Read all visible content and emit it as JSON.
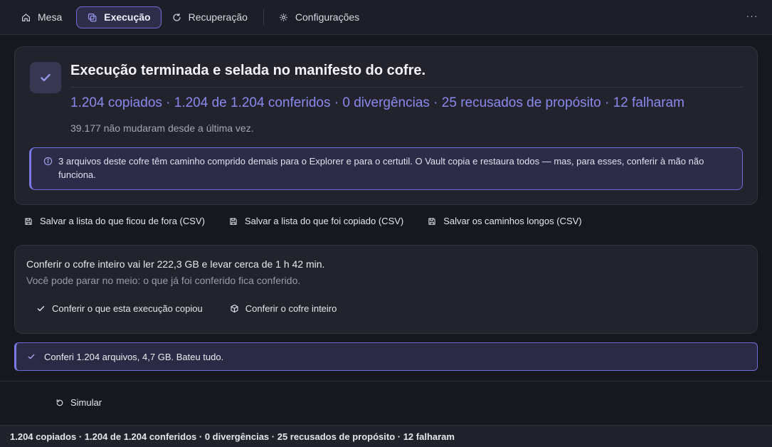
{
  "tabs": [
    {
      "label": "Mesa",
      "icon": "home-icon"
    },
    {
      "label": "Execução",
      "icon": "copy-icon",
      "active": true
    },
    {
      "label": "Recuperação",
      "icon": "refresh-icon"
    },
    {
      "label": "Configurações",
      "icon": "gear-icon"
    }
  ],
  "result": {
    "title": "Execução terminada e selada no manifesto do cofre.",
    "summary": "1.204 copiados · 1.204 de 1.204 conferidos · 0 divergências · 25 recusados de propósito · 12 falharam",
    "unchanged_note": "39.177 não mudaram desde a última vez.",
    "info": "3 arquivos deste cofre têm caminho comprido demais para o Explorer e para o certutil. O Vault copia e restaura todos — mas, para esses, conferir à mão não funciona."
  },
  "save_actions": {
    "left_out": "Salvar a lista do que ficou de fora (CSV)",
    "copied": "Salvar a lista do que foi copiado (CSV)",
    "long_paths": "Salvar os caminhos longos (CSV)"
  },
  "verify": {
    "line1": "Conferir o cofre inteiro vai ler 222,3 GB e levar cerca de 1 h 42 min.",
    "line2": "Você pode parar no meio: o que já foi conferido fica conferido.",
    "verify_run_label": "Conferir o que esta execução copiou",
    "verify_all_label": "Conferir o cofre inteiro"
  },
  "success_message": "Conferi 1.204 arquivos, 4,7 GB. Bateu tudo.",
  "simulate_label": "Simular",
  "statusbar": "1.204 copiados · 1.204 de 1.204 conferidos · 0 divergências · 25 recusados de propósito · 12 falharam",
  "colors": {
    "accent": "#8a89ee",
    "background": "#17171f",
    "card": "#23232e"
  }
}
